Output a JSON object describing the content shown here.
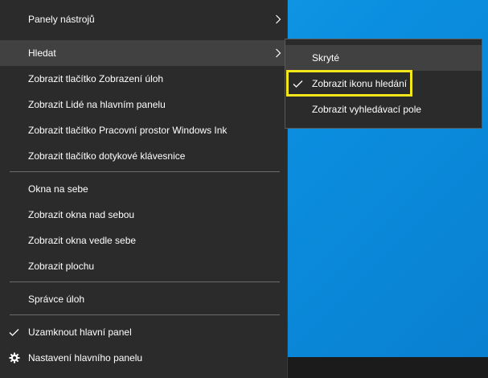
{
  "colors": {
    "menu_bg": "#2b2b2b",
    "hover_bg": "#414141",
    "separator": "#6b6b6b",
    "highlight": "#f5e61b",
    "desktop": "#0b8fe0"
  },
  "menu": {
    "items": [
      {
        "label": "Panely nástrojů",
        "icon": "chevron-right-icon"
      },
      {
        "label": "Hledat",
        "icon": "chevron-right-icon"
      },
      {
        "label": "Zobrazit tlačítko Zobrazení úloh"
      },
      {
        "label": "Zobrazit Lidé na hlavním panelu"
      },
      {
        "label": "Zobrazit tlačítko Pracovní prostor Windows Ink"
      },
      {
        "label": "Zobrazit tlačítko dotykové klávesnice"
      },
      {
        "label": "Okna na sebe"
      },
      {
        "label": "Zobrazit okna nad sebou"
      },
      {
        "label": "Zobrazit okna vedle sebe"
      },
      {
        "label": "Zobrazit plochu"
      },
      {
        "label": "Správce úloh"
      },
      {
        "label": "Uzamknout hlavní panel",
        "icon": "checkmark-icon"
      },
      {
        "label": "Nastavení hlavního panelu",
        "icon": "gear-icon"
      }
    ]
  },
  "submenu": {
    "items": [
      {
        "label": "Skryté"
      },
      {
        "label": "Zobrazit ikonu hledání",
        "icon": "checkmark-icon"
      },
      {
        "label": "Zobrazit vyhledávací pole"
      }
    ]
  }
}
